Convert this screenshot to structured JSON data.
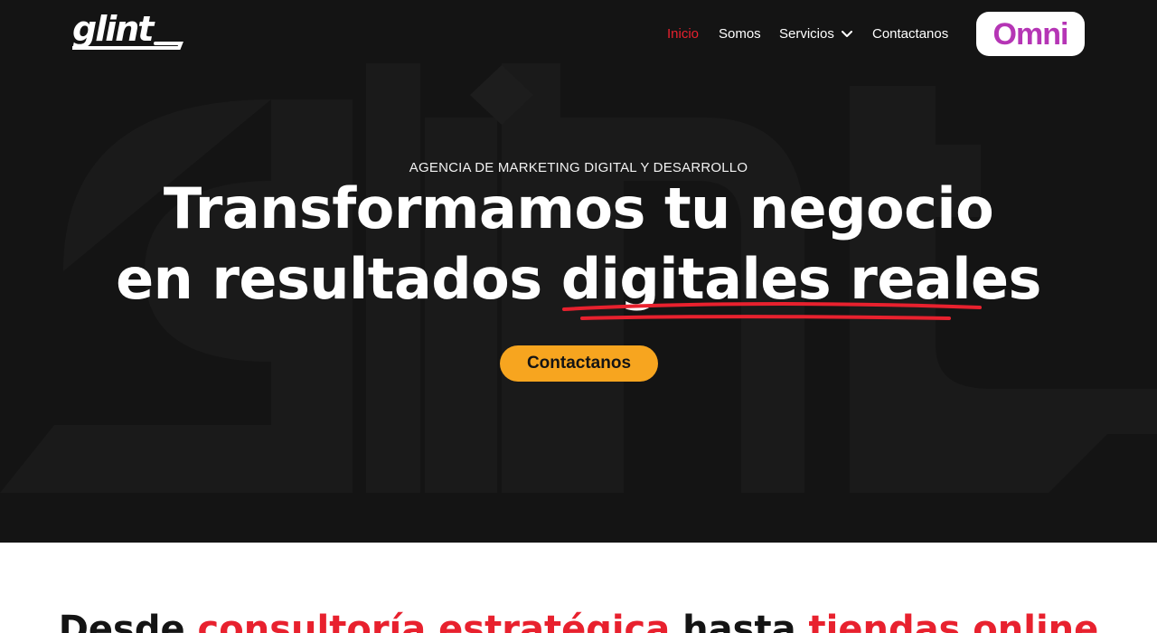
{
  "brand": {
    "logo_text": "glint",
    "partner_logo_text": "Omni"
  },
  "nav": {
    "items": [
      {
        "label": "Inicio",
        "active": true
      },
      {
        "label": "Somos",
        "active": false
      },
      {
        "label": "Servicios",
        "active": false,
        "has_dropdown": true
      },
      {
        "label": "Contactanos",
        "active": false
      }
    ]
  },
  "hero": {
    "eyebrow": "AGENCIA DE MARKETING DIGITAL Y DESARROLLO",
    "headline_line1": "Transformamos tu negocio",
    "headline_line2_plain": "en resultados ",
    "headline_line2_highlight": "digitales reales",
    "cta_label": "Contactanos"
  },
  "next_section": {
    "part1": "Desde ",
    "part2": "consultoría estratégica",
    "part3": " hasta ",
    "part4": "tiendas online"
  },
  "colors": {
    "hero_bg": "#141414",
    "accent_red": "#e8212e",
    "cta_yellow": "#f7a51f",
    "omni_purple": "#b535b5"
  },
  "icons": {
    "dropdown": "chevron-down-icon"
  }
}
